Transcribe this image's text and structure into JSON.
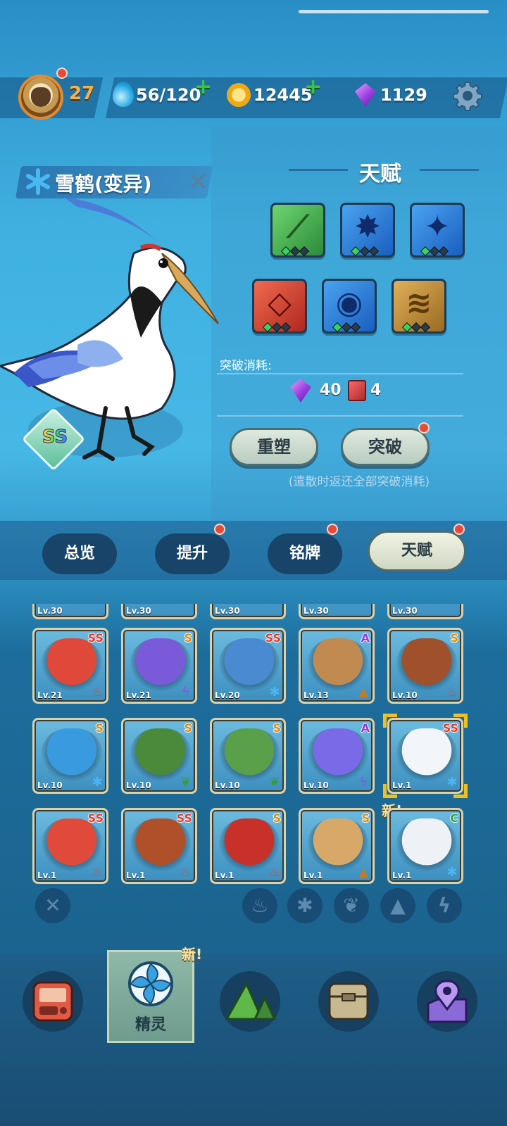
{
  "top_bar": {
    "player_level": "27",
    "energy": "56/120",
    "coins": "12445",
    "gems": "1129"
  },
  "monster": {
    "name": "雪鹤(变异)",
    "rank": "SS",
    "element": "ice"
  },
  "talent_panel": {
    "title": "天赋",
    "breakthrough_cost_label": "突破消耗:",
    "cost_gems": "40",
    "cost_books": "4",
    "reshape_button": "重塑",
    "breakthrough_button": "突破",
    "note": "(遣散时返还全部突破消耗)",
    "talents": [
      {
        "icon": "claw-slash-icon",
        "color": "green",
        "pips_on": 1
      },
      {
        "icon": "spike-ball-icon",
        "color": "blue",
        "pips_on": 1
      },
      {
        "icon": "ice-shard-icon",
        "color": "blue",
        "pips_on": 1
      },
      {
        "icon": "fang-mouth-icon",
        "color": "red",
        "pips_on": 1
      },
      {
        "icon": "eye-icon",
        "color": "blue",
        "pips_on": 1
      },
      {
        "icon": "shell-stack-icon",
        "color": "brown",
        "pips_on": 1
      }
    ]
  },
  "tabs": {
    "overview": "总览",
    "upgrade": "提升",
    "nameplate": "铭牌",
    "talent": "天赋"
  },
  "grid": {
    "partial_row_level": "Lv.30",
    "rows": [
      [
        {
          "level": "Lv.21",
          "rank": "SS",
          "element": "fire",
          "art": "red-dragon"
        },
        {
          "level": "Lv.21",
          "rank": "S",
          "element": "electric",
          "art": "purple-imp"
        },
        {
          "level": "Lv.20",
          "rank": "SS",
          "element": "ice",
          "art": "blue-owl"
        },
        {
          "level": "Lv.13",
          "rank": "A",
          "element": "earth",
          "art": "brown-beast"
        },
        {
          "level": "Lv.10",
          "rank": "S",
          "element": "fire",
          "art": "rust-robot"
        }
      ],
      [
        {
          "level": "Lv.10",
          "rank": "S",
          "element": "ice",
          "art": "blue-fish"
        },
        {
          "level": "Lv.10",
          "rank": "S",
          "element": "grass",
          "art": "green-hood"
        },
        {
          "level": "Lv.10",
          "rank": "S",
          "element": "grass",
          "art": "cactus"
        },
        {
          "level": "Lv.10",
          "rank": "A",
          "element": "electric",
          "art": "jellyfish"
        },
        {
          "level": "Lv.1",
          "rank": "SS",
          "element": "ice",
          "art": "snow-crane",
          "selected": true
        }
      ],
      [
        {
          "level": "Lv.1",
          "rank": "SS",
          "element": "fire",
          "art": "red-blob"
        },
        {
          "level": "Lv.1",
          "rank": "SS",
          "element": "fire",
          "art": "boiler-bot"
        },
        {
          "level": "Lv.1",
          "rank": "S",
          "element": "fire",
          "art": "bull-demon"
        },
        {
          "level": "Lv.1",
          "rank": "S",
          "element": "earth",
          "art": "potato-sprout"
        },
        {
          "level": "Lv.1",
          "rank": "C",
          "element": "ice",
          "art": "white-owl"
        }
      ]
    ],
    "new_tag": "新!"
  },
  "bottom_nav": {
    "active_label": "精灵",
    "new_tag": "新!"
  },
  "colors": {
    "accent_orange": "#e48a2d",
    "plus_green": "#39c24a",
    "notify_red": "#e64b3a"
  }
}
